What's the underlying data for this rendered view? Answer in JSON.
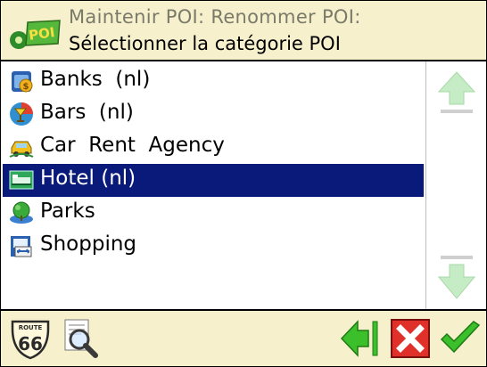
{
  "header": {
    "title_line1": "Maintenir POI: Renommer POI:",
    "title_line2": "Sélectionner la catégorie POI",
    "logo_icon": "poi-logo-icon",
    "logo_text": "POI"
  },
  "list": {
    "items": [
      {
        "label": "Banks  (nl)",
        "icon": "bank-icon",
        "selected": false
      },
      {
        "label": "Bars  (nl)",
        "icon": "bar-icon",
        "selected": false
      },
      {
        "label": "Car  Rent  Agency",
        "icon": "car-rental-icon",
        "selected": false
      },
      {
        "label": "Hotel (nl)",
        "icon": "hotel-icon",
        "selected": true
      },
      {
        "label": "Parks",
        "icon": "park-icon",
        "selected": false
      },
      {
        "label": "Shopping",
        "icon": "shopping-icon",
        "selected": false
      }
    ],
    "selected_color": "#0a1a7a"
  },
  "scrollbar": {
    "up_icon": "scroll-up-icon",
    "down_icon": "scroll-down-icon"
  },
  "footer": {
    "route_sign_top": "ROUTE",
    "route_sign_number": "66",
    "route_icon": "route66-icon",
    "search_icon": "magnifier-icon",
    "back_icon": "back-arrow-icon",
    "cancel_icon": "cancel-icon",
    "ok_icon": "checkmark-icon",
    "colors": {
      "back": "#3bbf2a",
      "cancel": "#e0302a",
      "ok": "#3bbf2a",
      "bar": "#f7f0cc"
    }
  }
}
